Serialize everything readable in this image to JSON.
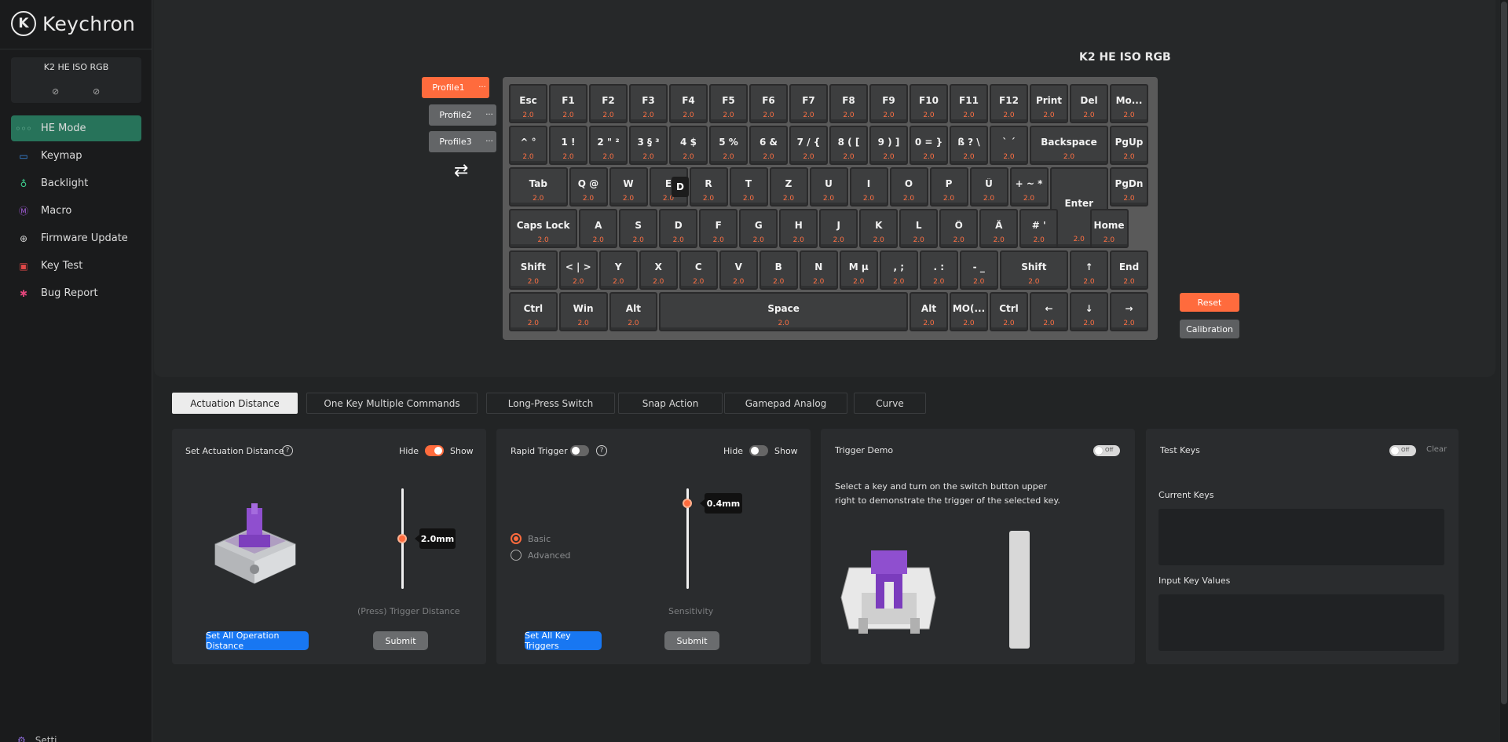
{
  "brand": {
    "logo_mark": "K",
    "name": "Keychron"
  },
  "device": {
    "name": "K2 HE ISO RGB",
    "icon_left": "link-icon",
    "icon_right": "unlink-icon"
  },
  "nav": [
    {
      "label": "HE Mode",
      "icon": "he-mode-icon",
      "glyph": "◦◦◦",
      "color": "#7fc4a8",
      "active": true
    },
    {
      "label": "Keymap",
      "icon": "keymap-icon",
      "glyph": "▭",
      "color": "#3b8ee8",
      "active": false
    },
    {
      "label": "Backlight",
      "icon": "bulb-icon",
      "glyph": "♁",
      "color": "#3ecf8e",
      "active": false
    },
    {
      "label": "Macro",
      "icon": "macro-icon",
      "glyph": "Ⓜ",
      "color": "#a05cd6",
      "active": false
    },
    {
      "label": "Firmware Update",
      "icon": "firmware-update-icon",
      "glyph": "⊕",
      "color": "#d0d0d0",
      "active": false
    },
    {
      "label": "Key Test",
      "icon": "key-test-icon",
      "glyph": "▣",
      "color": "#e04848",
      "active": false
    },
    {
      "label": "Bug Report",
      "icon": "bug-icon",
      "glyph": "✱",
      "color": "#e0457a",
      "active": false
    }
  ],
  "settings_peek": {
    "label": "Setti",
    "icon": "settings-icon"
  },
  "keyboard": {
    "title": "K2 HE ISO RGB",
    "profiles": [
      {
        "label": "Profile1",
        "more": "···",
        "active": true
      },
      {
        "label": "Profile2",
        "more": "···",
        "active": false
      },
      {
        "label": "Profile3",
        "more": "···",
        "active": false
      }
    ],
    "swap_icon": "⇄",
    "rows": [
      [
        {
          "l": "Esc",
          "v": "2.0"
        },
        {
          "l": "F1",
          "v": "2.0"
        },
        {
          "l": "F2",
          "v": "2.0"
        },
        {
          "l": "F3",
          "v": "2.0"
        },
        {
          "l": "F4",
          "v": "2.0"
        },
        {
          "l": "F5",
          "v": "2.0"
        },
        {
          "l": "F6",
          "v": "2.0"
        },
        {
          "l": "F7",
          "v": "2.0"
        },
        {
          "l": "F8",
          "v": "2.0"
        },
        {
          "l": "F9",
          "v": "2.0"
        },
        {
          "l": "F10",
          "v": "2.0"
        },
        {
          "l": "F11",
          "v": "2.0"
        },
        {
          "l": "F12",
          "v": "2.0"
        },
        {
          "l": "Print",
          "v": "2.0"
        },
        {
          "l": "Del",
          "v": "2.0"
        },
        {
          "l": "Mo...",
          "v": "2.0"
        }
      ],
      [
        {
          "l": "^ °",
          "v": "2.0"
        },
        {
          "l": "1 !",
          "v": "2.0"
        },
        {
          "l": "2 \" ²",
          "v": "2.0"
        },
        {
          "l": "3 § ³",
          "v": "2.0"
        },
        {
          "l": "4 $",
          "v": "2.0"
        },
        {
          "l": "5 %",
          "v": "2.0"
        },
        {
          "l": "6 &",
          "v": "2.0"
        },
        {
          "l": "7 / {",
          "v": "2.0"
        },
        {
          "l": "8 ( [",
          "v": "2.0"
        },
        {
          "l": "9 ) ]",
          "v": "2.0"
        },
        {
          "l": "0 = }",
          "v": "2.0"
        },
        {
          "l": "ß ? \\",
          "v": "2.0"
        },
        {
          "l": "` ´",
          "v": "2.0"
        },
        {
          "l": "Backspace",
          "v": "2.0"
        },
        {
          "l": "PgUp",
          "v": "2.0"
        }
      ],
      [
        {
          "l": "Tab",
          "v": "2.0"
        },
        {
          "l": "Q @",
          "v": "2.0"
        },
        {
          "l": "W",
          "v": "2.0"
        },
        {
          "l": "E",
          "v": "2.0"
        },
        {
          "l": "R",
          "v": "2.0"
        },
        {
          "l": "T",
          "v": "2.0"
        },
        {
          "l": "Z",
          "v": "2.0"
        },
        {
          "l": "U",
          "v": "2.0"
        },
        {
          "l": "I",
          "v": "2.0"
        },
        {
          "l": "O",
          "v": "2.0"
        },
        {
          "l": "P",
          "v": "2.0"
        },
        {
          "l": "Ü",
          "v": "2.0"
        },
        {
          "l": "+ ~ *",
          "v": "2.0"
        },
        {
          "l": "Enter",
          "v": "2.0"
        },
        {
          "l": "PgDn",
          "v": "2.0"
        }
      ],
      [
        {
          "l": "Caps Lock",
          "v": "2.0"
        },
        {
          "l": "A",
          "v": "2.0"
        },
        {
          "l": "S",
          "v": "2.0"
        },
        {
          "l": "D",
          "v": "2.0"
        },
        {
          "l": "F",
          "v": "2.0"
        },
        {
          "l": "G",
          "v": "2.0"
        },
        {
          "l": "H",
          "v": "2.0"
        },
        {
          "l": "J",
          "v": "2.0"
        },
        {
          "l": "K",
          "v": "2.0"
        },
        {
          "l": "L",
          "v": "2.0"
        },
        {
          "l": "Ö",
          "v": "2.0"
        },
        {
          "l": "Ä",
          "v": "2.0"
        },
        {
          "l": "# '",
          "v": "2.0"
        },
        {
          "l": "Home",
          "v": "2.0"
        }
      ],
      [
        {
          "l": "Shift",
          "v": "2.0"
        },
        {
          "l": "< | >",
          "v": "2.0"
        },
        {
          "l": "Y",
          "v": "2.0"
        },
        {
          "l": "X",
          "v": "2.0"
        },
        {
          "l": "C",
          "v": "2.0"
        },
        {
          "l": "V",
          "v": "2.0"
        },
        {
          "l": "B",
          "v": "2.0"
        },
        {
          "l": "N",
          "v": "2.0"
        },
        {
          "l": "M µ",
          "v": "2.0"
        },
        {
          "l": ", ;",
          "v": "2.0"
        },
        {
          "l": ". :",
          "v": "2.0"
        },
        {
          "l": "- _",
          "v": "2.0"
        },
        {
          "l": "Shift",
          "v": "2.0"
        },
        {
          "l": "↑",
          "v": "2.0"
        },
        {
          "l": "End",
          "v": "2.0"
        }
      ],
      [
        {
          "l": "Ctrl",
          "v": "2.0"
        },
        {
          "l": "Win",
          "v": "2.0"
        },
        {
          "l": "Alt",
          "v": "2.0"
        },
        {
          "l": "Space",
          "v": "2.0"
        },
        {
          "l": "Alt",
          "v": "2.0"
        },
        {
          "l": "MO(...",
          "v": "2.0"
        },
        {
          "l": "Ctrl",
          "v": "2.0"
        },
        {
          "l": "←",
          "v": "2.0"
        },
        {
          "l": "↓",
          "v": "2.0"
        },
        {
          "l": "→",
          "v": "2.0"
        }
      ]
    ],
    "tooltip_letter": "D",
    "reset_label": "Reset",
    "calibration_label": "Calibration"
  },
  "tabs": [
    {
      "label": "Actuation Distance",
      "active": true
    },
    {
      "label": "One Key Multiple Commands",
      "active": false
    },
    {
      "label": "Long-Press Switch",
      "active": false
    },
    {
      "label": "Snap Action",
      "active": false
    },
    {
      "label": "Gamepad Analog",
      "active": false
    },
    {
      "label": "Curve",
      "active": false
    }
  ],
  "actuation": {
    "title": "Set Actuation Distance",
    "help": "?",
    "hide": "Hide",
    "show": "Show",
    "show_on": true,
    "value": "2.0mm",
    "level": 0.5,
    "caption": "(Press) Trigger Distance",
    "set_all": "Set All Operation Distance",
    "submit": "Submit"
  },
  "rapid": {
    "title": "Rapid Trigger",
    "help": "?",
    "enabled": false,
    "hide": "Hide",
    "show": "Show",
    "show_on": false,
    "value": "0.4mm",
    "level": 0.85,
    "modes": [
      {
        "label": "Basic",
        "selected": true
      },
      {
        "label": "Advanced",
        "selected": false
      }
    ],
    "caption": "Sensitivity",
    "set_all": "Set All Key Triggers",
    "submit": "Submit"
  },
  "demo": {
    "title": "Trigger Demo",
    "toggle": "Off",
    "text": "Select a key and turn on the switch button upper right to demonstrate the trigger of the selected key."
  },
  "test": {
    "title": "Test Keys",
    "toggle": "Off",
    "clear": "Clear",
    "current_label": "Current Keys",
    "input_label": "Input Key Values"
  },
  "colors": {
    "accent": "#ff6b3d",
    "active_nav": "#27735a",
    "primary_button": "#1877f2",
    "switch_purple": "#8f4fcf"
  }
}
